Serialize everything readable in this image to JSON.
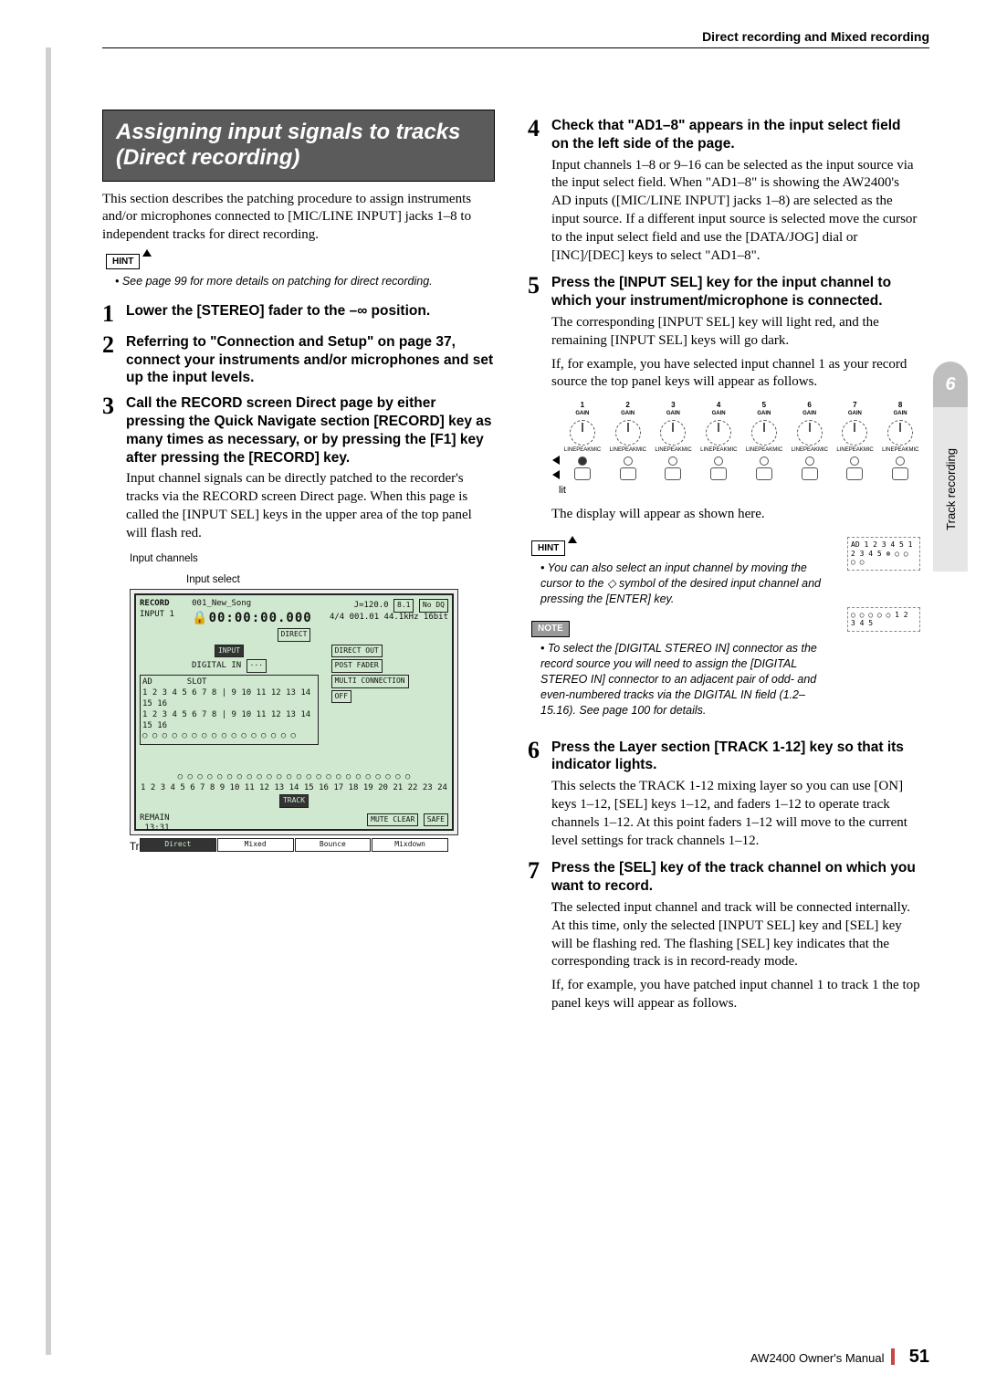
{
  "header": {
    "breadcrumb": "Direct recording and Mixed recording"
  },
  "tab": {
    "number": "6",
    "label": "Track recording"
  },
  "section": {
    "title": "Assigning input signals to tracks (Direct recording)"
  },
  "intro": "This section describes the patching procedure to assign instruments and/or microphones connected to [MIC/LINE INPUT] jacks 1–8 to independent tracks for direct recording.",
  "hint_label": "HINT",
  "note_label": "NOTE",
  "hints": {
    "h1": "• See page 99 for more details on patching for direct recording.",
    "h2": "• You can also select an input channel by moving the cursor to the ◇ symbol of the desired input channel and pressing the [ENTER] key.",
    "h3": "• To select the [DIGITAL STEREO IN] connector as the record source you will need to assign the [DIGITAL STEREO IN] connector to an adjacent pair of odd- and even-numbered tracks via the DIGITAL IN field (1.2–15.16). See page 100 for details."
  },
  "steps": {
    "s1": {
      "n": "1",
      "head": "Lower the [STEREO] fader to the –∞ position."
    },
    "s2": {
      "n": "2",
      "head": "Referring to \"Connection and Setup\" on page 37, connect your instruments and/or microphones and set up the input levels."
    },
    "s3": {
      "n": "3",
      "head": "Call the RECORD screen Direct page by either pressing the Quick Navigate section [RECORD] key as many times as necessary, or by pressing the [F1] key after pressing the [RECORD] key.",
      "body": "Input channel signals can be directly patched to the recorder's tracks via the RECORD screen Direct page. When this page is called the [INPUT SEL] keys in the upper area of the top panel will flash red."
    },
    "s4": {
      "n": "4",
      "head": "Check that \"AD1–8\" appears in the input select field on the left side of the page.",
      "body": "Input channels 1–8 or 9–16 can be selected as the input source via the input select field. When \"AD1–8\" is showing the AW2400's AD inputs ([MIC/LINE INPUT] jacks 1–8) are selected as the input source. If a different input source is selected move the cursor to the input select field and use the [DATA/JOG] dial or [INC]/[DEC] keys to select \"AD1–8\"."
    },
    "s5": {
      "n": "5",
      "head": "Press the [INPUT SEL] key for the input channel to which your instrument/microphone is connected.",
      "body1": "The corresponding [INPUT SEL] key will light red, and the remaining [INPUT SEL] keys will go dark.",
      "body2": "If, for example, you have selected input channel 1 as your record source the top panel keys will appear as follows.",
      "body3": "The display will appear as shown here."
    },
    "s6": {
      "n": "6",
      "head": "Press the Layer section [TRACK 1-12] key so that its indicator lights.",
      "body": "This selects the TRACK 1-12 mixing layer so you can use [ON] keys 1–12, [SEL] keys 1–12, and faders 1–12 to operate track channels 1–12. At this point faders 1–12 will move to the current level settings for track channels 1–12."
    },
    "s7": {
      "n": "7",
      "head": "Press the [SEL] key of the track channel on which you want to record.",
      "body1": "The selected input channel and track will be connected internally. At this time, only the selected [INPUT SEL] key and [SEL] key will be flashing red. The flashing [SEL] key indicates that the corresponding track is in record-ready mode.",
      "body2": "If, for example, you have patched input channel 1 to track 1 the top panel keys will appear as follows."
    }
  },
  "captions": {
    "input_channels": "Input channels",
    "input_select": "Input select",
    "tracks": "Tracks",
    "lit": "lit"
  },
  "lcd": {
    "title": "RECORD",
    "sub": "INPUT 1",
    "song": "001_New_Song",
    "time": "00:00:00.000",
    "tempo": "J=120.0",
    "sig": "4/4",
    "meter": "8.1",
    "nodq": "No DQ",
    "rate": "001.01 44.1kHz 16bit",
    "direct": "DIRECT",
    "input_lbl": "INPUT",
    "digital_in": "DIGITAL IN",
    "ad": "AD",
    "slot": "SLOT",
    "direct_out": "DIRECT OUT",
    "post_fader": "POST FADER",
    "multi_conn": "MULTI CONNECTION",
    "off": "OFF",
    "track_lbl": "TRACK",
    "remain": "REMAIN",
    "remain_t": "13:31",
    "mute_clear": "MUTE CLEAR",
    "safe": "SAFE",
    "tab_direct": "Direct",
    "tab_mixed": "Mixed",
    "tab_bounce": "Bounce",
    "tab_mixdown": "Mixdown"
  },
  "knob_labels": {
    "gain": "GAIN",
    "line": "LINE",
    "mic": "MIC",
    "peak": "PEAK"
  },
  "footer": {
    "manual": "AW2400  Owner's Manual",
    "page": "51"
  },
  "small_diag": {
    "a": "AD\n1 2 3 4 5\n1 2 3 4 5\n⊗ ○ ○ ○ ○",
    "b": "○ ○ ○ ○ ○\n1 2 3 4 5"
  }
}
